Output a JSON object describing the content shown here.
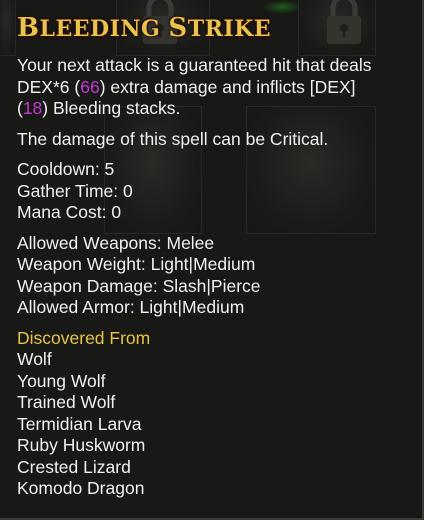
{
  "tooltip": {
    "title_first": "B",
    "title_rest": "LEEDING ",
    "title_second_cap": "S",
    "title_second_rest": "TRIKE",
    "description": {
      "line1": "Your next attack is a guaranteed hit that deals",
      "line2_a": "DEX*6 (",
      "line2_value": "66",
      "line2_b": ") extra damage and inflicts [DEX]",
      "line3_a": "(",
      "line3_value": "18",
      "line3_b": ") Bleeding stacks."
    },
    "critical_note": "The damage of this spell can be Critical.",
    "stats": [
      "Cooldown: 5",
      "Gather Time: 0",
      "Mana Cost: 0"
    ],
    "requirements": [
      "Allowed Weapons: Melee",
      "Weapon Weight: Light|Medium",
      "Weapon Damage: Slash|Pierce",
      "Allowed Armor: Light|Medium"
    ],
    "discovered_heading": "Discovered From",
    "discovered_from": [
      "Wolf",
      "Young Wolf",
      "Trained Wolf",
      "Termidian Larva",
      "Ruby Huskworm",
      "Crested Lizard",
      "Komodo Dragon"
    ]
  },
  "colors": {
    "title": "#e9c44a",
    "highlight_number": "#c73ad6",
    "text": "#f0f0f0",
    "background": "#181816"
  },
  "icons": {
    "background_locks": [
      "lock-icon",
      "lock-icon"
    ]
  }
}
